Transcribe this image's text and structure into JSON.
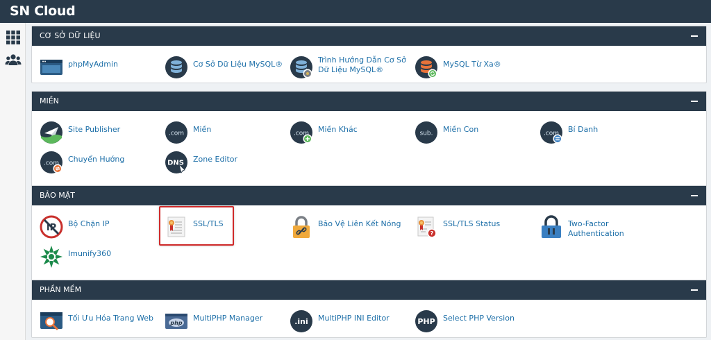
{
  "app": {
    "title": "SN Cloud"
  },
  "sidebar": {
    "items": [
      {
        "icon": "grid-icon"
      },
      {
        "icon": "users-icon"
      }
    ]
  },
  "sections": [
    {
      "title": "CƠ SỞ DỮ LIỆU",
      "items": [
        {
          "label": "phpMyAdmin",
          "icon": "phpmyadmin-icon"
        },
        {
          "label": "Cơ Sở Dữ Liệu MySQL®",
          "icon": "mysql-database-icon"
        },
        {
          "label": "Trình Hướng Dẫn Cơ Sở Dữ Liệu MySQL®",
          "icon": "mysql-wizard-icon"
        },
        {
          "label": "MySQL Từ Xa®",
          "icon": "remote-mysql-icon"
        }
      ]
    },
    {
      "title": "MIỀN",
      "items": [
        {
          "label": "Site Publisher",
          "icon": "site-publisher-icon"
        },
        {
          "label": "Miền",
          "icon": "domain-icon",
          "badge": ".com"
        },
        {
          "label": "Miền Khác",
          "icon": "addon-domain-icon",
          "badge": ".com"
        },
        {
          "label": "Miền Con",
          "icon": "subdomain-icon",
          "badge": "sub."
        },
        {
          "label": "Bí Danh",
          "icon": "alias-icon",
          "badge": ".com"
        },
        {
          "label": "Chuyển Hướng",
          "icon": "redirect-icon",
          "badge": ".com"
        },
        {
          "label": "Zone Editor",
          "icon": "dns-icon",
          "badge": "DNS"
        }
      ]
    },
    {
      "title": "BẢO MẬT",
      "items": [
        {
          "label": "Bộ Chặn IP",
          "icon": "ip-blocker-icon",
          "badge": "IP"
        },
        {
          "label": "SSL/TLS",
          "icon": "ssl-certificate-icon",
          "highlighted": true
        },
        {
          "label": "Bảo Vệ Liên Kết Nóng",
          "icon": "hotlink-lock-icon"
        },
        {
          "label": "SSL/TLS Status",
          "icon": "ssl-status-icon"
        },
        {
          "label": "Two-Factor Authentication",
          "icon": "two-factor-lock-icon"
        },
        {
          "label": "Imunify360",
          "icon": "imunify360-icon"
        }
      ]
    },
    {
      "title": "PHẦN MỀM",
      "items": [
        {
          "label": "Tối Ưu Hóa Trang Web",
          "icon": "optimize-website-icon"
        },
        {
          "label": "MultiPHP Manager",
          "icon": "multiphp-manager-icon",
          "badge": "php"
        },
        {
          "label": "MultiPHP INI Editor",
          "icon": "ini-editor-icon",
          "badge": ".ini"
        },
        {
          "label": "Select PHP Version",
          "icon": "php-version-icon",
          "badge": "PHP"
        }
      ]
    }
  ],
  "colors": {
    "header": "#293a4a",
    "link": "#1d6fa8",
    "highlight": "#cf2a2a"
  }
}
